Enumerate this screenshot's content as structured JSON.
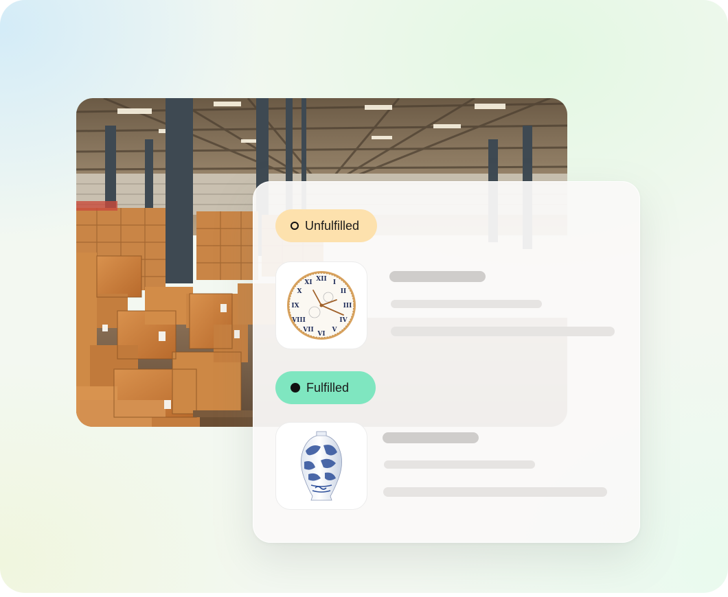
{
  "hero": {
    "image": "warehouse-photo"
  },
  "orders": [
    {
      "status": "Unfulfilled",
      "status_icon": "open-circle-icon",
      "status_color": "#fde1ad",
      "product_image": "wall-clock"
    },
    {
      "status": "Fulfilled",
      "status_icon": "filled-circle-icon",
      "status_color": "#7fe6c0",
      "product_image": "blue-white-vase"
    }
  ]
}
